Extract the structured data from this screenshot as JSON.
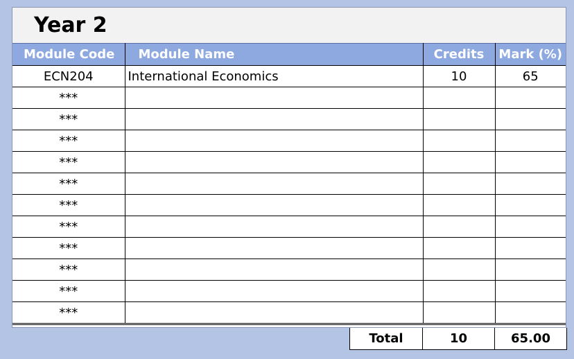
{
  "title": "Year 2",
  "headers": {
    "module_code": "Module Code",
    "module_name": "Module Name",
    "credits": "Credits",
    "mark": "Mark (%)"
  },
  "rows": [
    {
      "code": "ECN204",
      "name": "International Economics",
      "credits": "10",
      "mark": "65"
    },
    {
      "code": "***",
      "name": "",
      "credits": "",
      "mark": ""
    },
    {
      "code": "***",
      "name": "",
      "credits": "",
      "mark": ""
    },
    {
      "code": "***",
      "name": "",
      "credits": "",
      "mark": ""
    },
    {
      "code": "***",
      "name": "",
      "credits": "",
      "mark": ""
    },
    {
      "code": "***",
      "name": "",
      "credits": "",
      "mark": ""
    },
    {
      "code": "***",
      "name": "",
      "credits": "",
      "mark": ""
    },
    {
      "code": "***",
      "name": "",
      "credits": "",
      "mark": ""
    },
    {
      "code": "***",
      "name": "",
      "credits": "",
      "mark": ""
    },
    {
      "code": "***",
      "name": "",
      "credits": "",
      "mark": ""
    },
    {
      "code": "***",
      "name": "",
      "credits": "",
      "mark": ""
    },
    {
      "code": "***",
      "name": "",
      "credits": "",
      "mark": ""
    }
  ],
  "totals": {
    "label": "Total",
    "credits": "10",
    "mark": "65.00"
  },
  "colors": {
    "background": "#b4c4e4",
    "header_fill": "#8ea9e0",
    "title_bar": "#f2f2f2"
  }
}
